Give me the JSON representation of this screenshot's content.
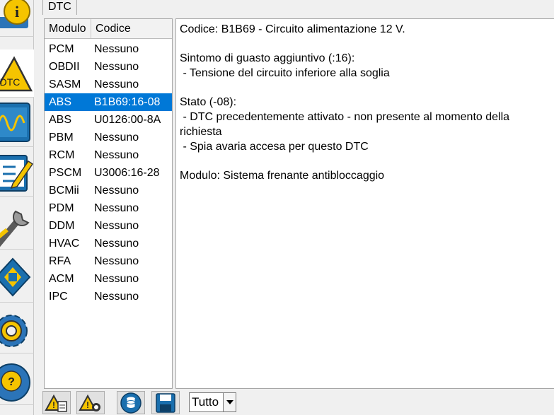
{
  "tabs": [
    {
      "label": "DTC"
    }
  ],
  "module_list": {
    "headers": {
      "modulo": "Modulo",
      "codice": "Codice"
    },
    "rows": [
      {
        "modulo": "PCM",
        "codice": "Nessuno"
      },
      {
        "modulo": "OBDII",
        "codice": "Nessuno"
      },
      {
        "modulo": "SASM",
        "codice": "Nessuno"
      },
      {
        "modulo": "ABS",
        "codice": "B1B69:16-08"
      },
      {
        "modulo": "ABS",
        "codice": "U0126:00-8A"
      },
      {
        "modulo": "PBM",
        "codice": "Nessuno"
      },
      {
        "modulo": "RCM",
        "codice": "Nessuno"
      },
      {
        "modulo": "PSCM",
        "codice": "U3006:16-28"
      },
      {
        "modulo": "BCMii",
        "codice": "Nessuno"
      },
      {
        "modulo": "PDM",
        "codice": "Nessuno"
      },
      {
        "modulo": "DDM",
        "codice": "Nessuno"
      },
      {
        "modulo": "HVAC",
        "codice": "Nessuno"
      },
      {
        "modulo": "RFA",
        "codice": "Nessuno"
      },
      {
        "modulo": "ACM",
        "codice": "Nessuno"
      },
      {
        "modulo": "IPC",
        "codice": "Nessuno"
      }
    ],
    "selected_index": 3
  },
  "detail": {
    "codice_line": "Codice: B1B69 - Circuito alimentazione 12 V.",
    "sintomo_title": "Sintomo di guasto aggiuntivo (:16):",
    "sintomo_line": " - Tensione del circuito inferiore alla soglia",
    "stato_title": "Stato (-08):",
    "stato_line1": " - DTC precedentemente attivato - non presente al momento della richiesta",
    "stato_line2": " - Spia avaria accesa per questo DTC",
    "modulo_line": "Modulo: Sistema frenante antibloccaggio"
  },
  "sidebar_icons": [
    "info-icon",
    "dtc-warning-icon",
    "oscilloscope-icon",
    "checklist-edit-icon",
    "wrench-icon",
    "chip-module-icon",
    "settings-gear-icon",
    "help-icon"
  ],
  "sidebar_active": "dtc-warning-icon",
  "toolbar": {
    "icons": [
      "dtc-report-icon",
      "dtc-clear-icon",
      "database-icon",
      "save-icon"
    ],
    "filter_value": "Tutto"
  },
  "colors": {
    "selection": "#0078d7",
    "accent_blue": "#1a6fae",
    "warning_yellow": "#f5c400"
  }
}
